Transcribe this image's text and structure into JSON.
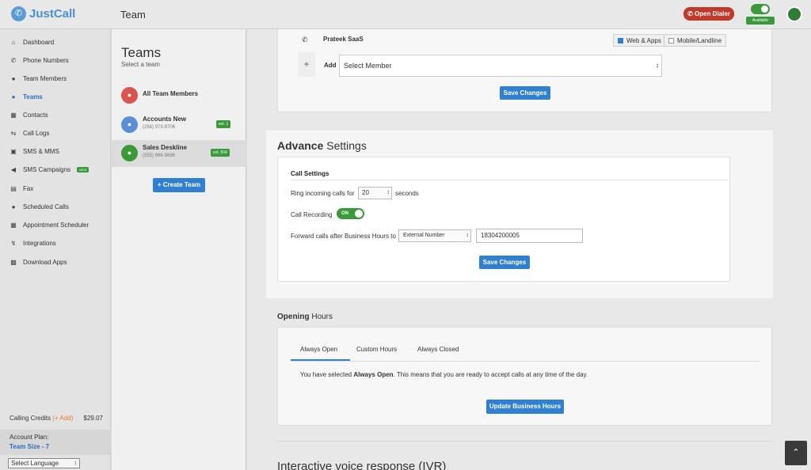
{
  "app": {
    "logo_icon": "phone-icon",
    "logo_text": "JustCall",
    "page_title": "Team"
  },
  "header": {
    "open_dialer": "Open Dialer",
    "status": "Available"
  },
  "sidebar": {
    "items": [
      {
        "label": "Dashboard",
        "icon": "home-icon"
      },
      {
        "label": "Phone Numbers",
        "icon": "phone-icon"
      },
      {
        "label": "Team Members",
        "icon": "users-icon"
      },
      {
        "label": "Teams",
        "icon": "group-icon"
      },
      {
        "label": "Contacts",
        "icon": "contact-card-icon"
      },
      {
        "label": "Call Logs",
        "icon": "call-logs-icon"
      },
      {
        "label": "SMS & MMS",
        "icon": "sms-icon"
      },
      {
        "label": "SMS Campaigns",
        "icon": "megaphone-icon",
        "badge": "NEW"
      },
      {
        "label": "Fax",
        "icon": "fax-icon"
      },
      {
        "label": "Scheduled Calls",
        "icon": "clock-icon"
      },
      {
        "label": "Appointment Scheduler",
        "icon": "calendar-icon"
      },
      {
        "label": "Integrations",
        "icon": "plug-icon"
      },
      {
        "label": "Download Apps",
        "icon": "grid-icon"
      }
    ],
    "credits_label": "Calling Credits",
    "credits_add": "(+ Add)",
    "credits_value": "$29.07",
    "plan_label": "Account Plan:",
    "plan_value": "Team Size - 7",
    "language_select": "Select Language"
  },
  "teams": {
    "title": "Teams",
    "subtitle": "Select a team",
    "items": [
      {
        "name": "All Team Members",
        "phone": "",
        "ext": "",
        "color": "#d9534f"
      },
      {
        "name": "Accounts New",
        "phone": "(256) 973-9706",
        "ext": "ext. 1",
        "color": "#5a8fd6"
      },
      {
        "name": "Sales Deskline",
        "phone": "(555) 966-5696",
        "ext": "ext. 504",
        "color": "#3a9a3a"
      }
    ],
    "create_button": "+ Create Team"
  },
  "members": {
    "member_name": "Prateek SaaS",
    "web_apps": "Web & Apps",
    "mobile_landline": "Mobile/Landline",
    "plus": "+",
    "add_label": "Add",
    "select_member": "Select Member",
    "save": "Save Changes"
  },
  "advance": {
    "title_bold": "Advance",
    "title_rest": " Settings",
    "call_settings": "Call Settings",
    "ring_label": "Ring incoming calls for",
    "ring_value": "20",
    "seconds": "seconds",
    "recording_label": "Call Recording",
    "recording_toggle": "ON",
    "forward_label": "Forward calls after Business Hours to",
    "forward_type": "External Number",
    "forward_number": "18304200005",
    "save": "Save Changes"
  },
  "opening": {
    "title_bold": "Opening",
    "title_rest": " Hours",
    "tabs": [
      "Always Open",
      "Custom Hours",
      "Always Closed"
    ],
    "msg_pre": "You have selected ",
    "msg_bold": "Always Open",
    "msg_post": ". This means that you are ready to accept calls at any time of the day.",
    "update": "Update Business Hours"
  },
  "ivr": {
    "title": "Interactive voice response (IVR)"
  },
  "scroll_top_icon": "chevron-up-icon",
  "colors": {
    "accent": "#2f80d1",
    "success": "#3a9a3a",
    "danger": "#c0392b"
  }
}
